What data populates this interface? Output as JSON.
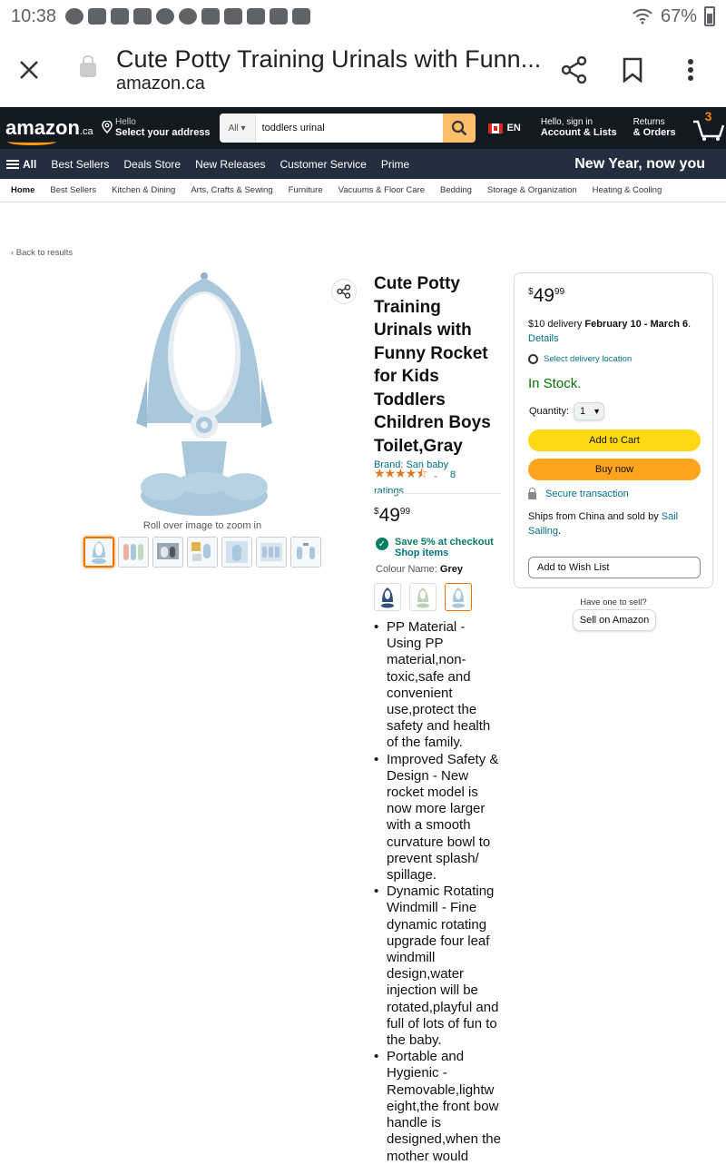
{
  "status_bar": {
    "time": "10:38",
    "battery": "67%"
  },
  "browser": {
    "page_title": "Cute Potty Training Urinals with Funn...",
    "url": "amazon.ca"
  },
  "header": {
    "logo_text": "amazon",
    "logo_suffix": ".ca",
    "address_small": "Hello",
    "address_big": "Select your address",
    "search_category": "All",
    "search_value": "toddlers urinal",
    "language": "EN",
    "account_small": "Hello, sign in",
    "account_big": "Account & Lists",
    "returns_small": "Returns",
    "returns_big": "& Orders",
    "cart_count": "3"
  },
  "nav": {
    "all_label": "All",
    "items": [
      "Best Sellers",
      "Deals Store",
      "New Releases",
      "Customer Service",
      "Prime"
    ],
    "promo": "New Year, now you"
  },
  "sub_nav": {
    "items": [
      "Home",
      "Best Sellers",
      "Kitchen & Dining",
      "Arts, Crafts & Sewing",
      "Furniture",
      "Vacuums & Floor Care",
      "Bedding",
      "Storage & Organization",
      "Heating & Cooling"
    ]
  },
  "product": {
    "back_link": "‹ Back to results",
    "zoom_hint": "Roll over image to zoom in",
    "title": "Cute Potty Training Urinals with Funny Rocket for Kids Toddlers Children Boys Toilet,Gray",
    "brand": "Brand: San baby",
    "rating_stars": "★★★★⯪",
    "rating_count": "8",
    "rating_label": "ratings",
    "price_symbol": "$",
    "price_whole": "49",
    "price_fraction": "99",
    "save_text": "Save 5% at checkout",
    "shop_items": "Shop items",
    "colour_label": "Colour Name:",
    "colour_value": "Grey",
    "bullets": [
      "PP Material - Using PP material,non-toxic,safe and convenient use,protect the safety and health of the family.",
      "Improved Safety & Design - New rocket model is now more larger with a smooth curvature bowl to prevent splash/ spillage.",
      "Dynamic Rotating Windmill - Fine dynamic rotating upgrade four leaf windmill design,water injection will be rotated,playful and full of lots of fun to the baby.",
      "Portable and Hygienic - Removable,lightw eight,the front bow handle is designed,when the mother would"
    ]
  },
  "buybox": {
    "price_symbol": "$",
    "price_whole": "49",
    "price_fraction": "99",
    "delivery_prefix": "$10 delivery ",
    "delivery_dates": "February 10 - March 6",
    "delivery_suffix": ".",
    "details": "Details",
    "location": "Select delivery location",
    "stock": "In Stock.",
    "quantity_label": "Quantity:",
    "quantity_value": "1",
    "add_to_cart": "Add to Cart",
    "buy_now": "Buy now",
    "secure": "Secure transaction",
    "ships_text": "Ships from China and sold by ",
    "seller": "Sail Sailing",
    "ships_suffix": ".",
    "wish_list": "Add to Wish List",
    "sell_question": "Have one to sell?",
    "sell_button": "Sell on Amazon"
  },
  "colors": {
    "header_bg": "#131921",
    "nav_bg": "#232f3e",
    "accent": "#ff9900",
    "cart_button": "#ffd814",
    "buy_button": "#ffa41c",
    "link": "#007185",
    "stock": "#007600",
    "product_blue": "#a9c8dc"
  }
}
